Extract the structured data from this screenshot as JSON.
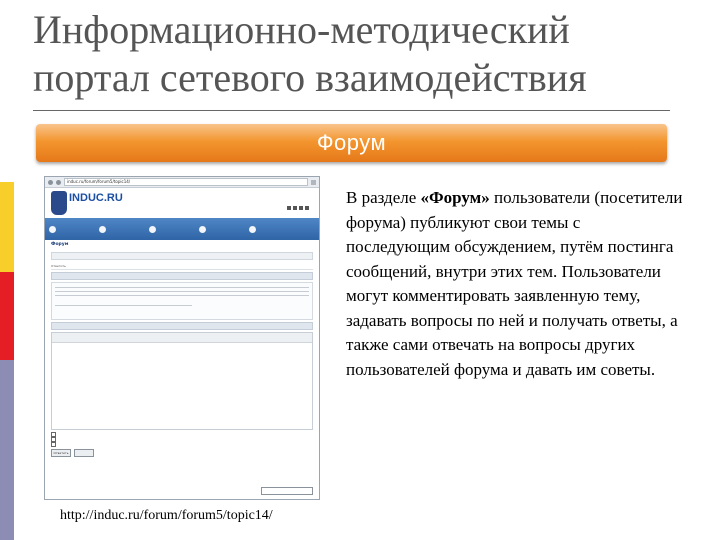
{
  "slide": {
    "title": "Информационно-методический портал сетевого взаимодействия",
    "banner": "Форум",
    "body_prefix": "В разделе ",
    "body_bold": "«Форум»",
    "body_rest": " пользователи (посетители форума) публикуют свои темы с последующим обсуждением, путём постинга сообщений, внутри этих тем. Пользователи могут комментировать заявленную тему, задавать вопросы по ней и получать ответы, а также сами отвечать на вопросы других пользователей форума и давать им советы.",
    "url_caption": "http://induc.ru/forum/forum5/topic14/"
  },
  "colors": {
    "left_bar_yellow": "#f7ce2a",
    "left_bar_red": "#e51e25",
    "left_bar_blue": "#8c8cb5",
    "banner_orange": "#f3962f",
    "site_blue": "#2f65a6"
  },
  "screenshot": {
    "address": "induc.ru/forum/forum5/topic14/",
    "logo": "INDUC.RU",
    "forum_heading": "Форум",
    "post_button": "Ответить",
    "reply_button": "Ответить"
  }
}
